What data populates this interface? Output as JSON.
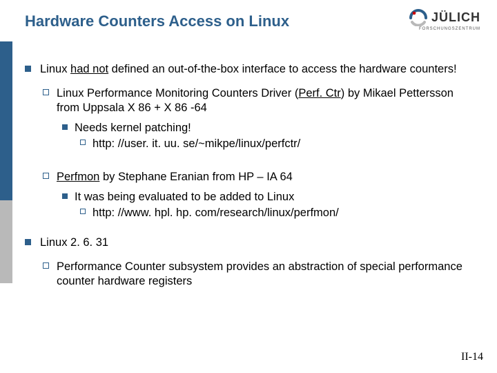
{
  "title": "Hardware Counters Access on Linux",
  "logo": {
    "text": "JÜLICH",
    "sub": "FORSCHUNGSZENTRUM"
  },
  "b1": {
    "pre": "Linux ",
    "u": "had not",
    "post": " defined an out-of-the-box interface to access the hardware counters!"
  },
  "s1": {
    "lead": "Linux",
    "mid": " Performance Monitoring Counters Driver (",
    "u": "Perf. Ctr",
    "post": ") by Mikael Pettersson from Uppsala X 86 + X 86 -64",
    "need": "Needs kernel patching!",
    "url": "http: //user. it. uu. se/~mikpe/linux/perfctr/"
  },
  "s2": {
    "lead": "Perfmon",
    "rest": " by Stephane Eranian from HP – IA 64",
    "eval": "It was being evaluated to be added to Linux",
    "url": "http: //www. hpl. hp. com/research/linux/perfmon/"
  },
  "b2": {
    "head": "Linux 2. 6. 31",
    "sub": "Performance",
    "rest": " Counter subsystem provides an abstraction of special performance counter hardware registers"
  },
  "pagenum_prefix": "II",
  "pagenum_suffix": "-14"
}
